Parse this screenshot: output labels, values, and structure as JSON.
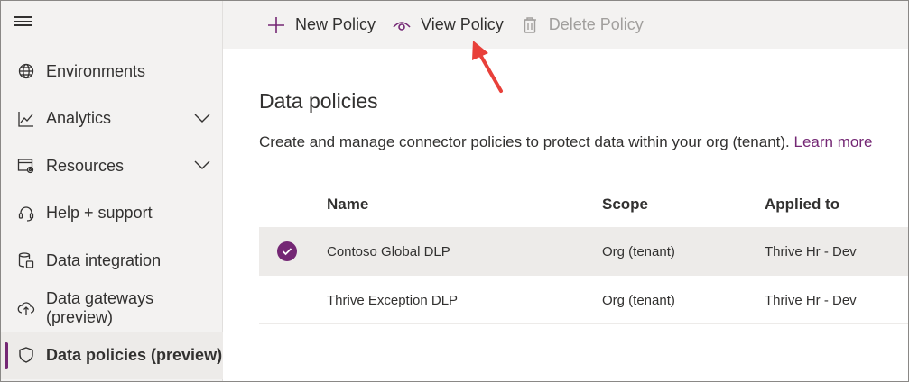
{
  "sidebar": {
    "items": [
      {
        "label": "Environments",
        "icon": "globe-icon"
      },
      {
        "label": "Analytics",
        "icon": "analytics-icon",
        "expandable": true
      },
      {
        "label": "Resources",
        "icon": "resources-icon",
        "expandable": true
      },
      {
        "label": "Help + support",
        "icon": "headset-icon"
      },
      {
        "label": "Data integration",
        "icon": "data-integration-icon"
      },
      {
        "label": "Data gateways (preview)",
        "icon": "cloud-upload-icon"
      },
      {
        "label": "Data policies (preview)",
        "icon": "shield-icon",
        "active": true
      }
    ]
  },
  "toolbar": {
    "new_policy": "New Policy",
    "view_policy": "View Policy",
    "delete_policy": "Delete Policy"
  },
  "main": {
    "title": "Data policies",
    "description": "Create and manage connector policies to protect data within your org (tenant).",
    "learn_more": "Learn more"
  },
  "table": {
    "headers": {
      "name": "Name",
      "scope": "Scope",
      "applied_to": "Applied to"
    },
    "rows": [
      {
        "name": "Contoso Global DLP",
        "scope": "Org (tenant)",
        "applied_to": "Thrive Hr - Dev",
        "selected": true
      },
      {
        "name": "Thrive Exception DLP",
        "scope": "Org (tenant)",
        "applied_to": "Thrive Hr - Dev",
        "selected": false
      }
    ]
  },
  "colors": {
    "accent": "#742774",
    "annotation_arrow": "#e8403a",
    "sidebar_bg": "#f3f2f1",
    "selected_row_bg": "#edebe9"
  }
}
